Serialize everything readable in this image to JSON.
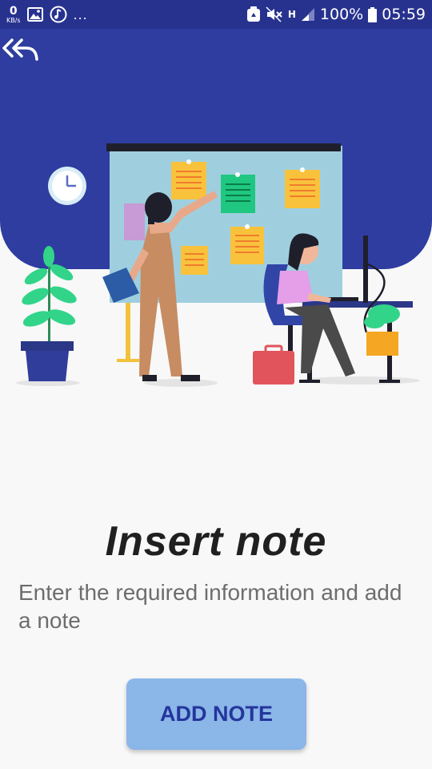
{
  "status_bar": {
    "net_speed_value": "0",
    "net_speed_unit": "KB/s",
    "more_indicator": "...",
    "network_type": "H",
    "battery_percent": "100%",
    "time": "05:59",
    "icons": [
      "image-icon",
      "music-icon",
      "recycle-icon",
      "mute-icon",
      "signal-icon",
      "battery-icon"
    ]
  },
  "header": {
    "back_icon": "double-back-arrow-icon",
    "background_color": "#2f3da0"
  },
  "content": {
    "title": "Insert note",
    "description": "Enter the required information and add a note",
    "button_label": "ADD NOTE"
  },
  "colors": {
    "accent": "#2f3da0",
    "button_bg": "#8ab6e8",
    "button_text": "#25359c",
    "title_text": "#202020",
    "description_text": "#6d6d6d"
  }
}
